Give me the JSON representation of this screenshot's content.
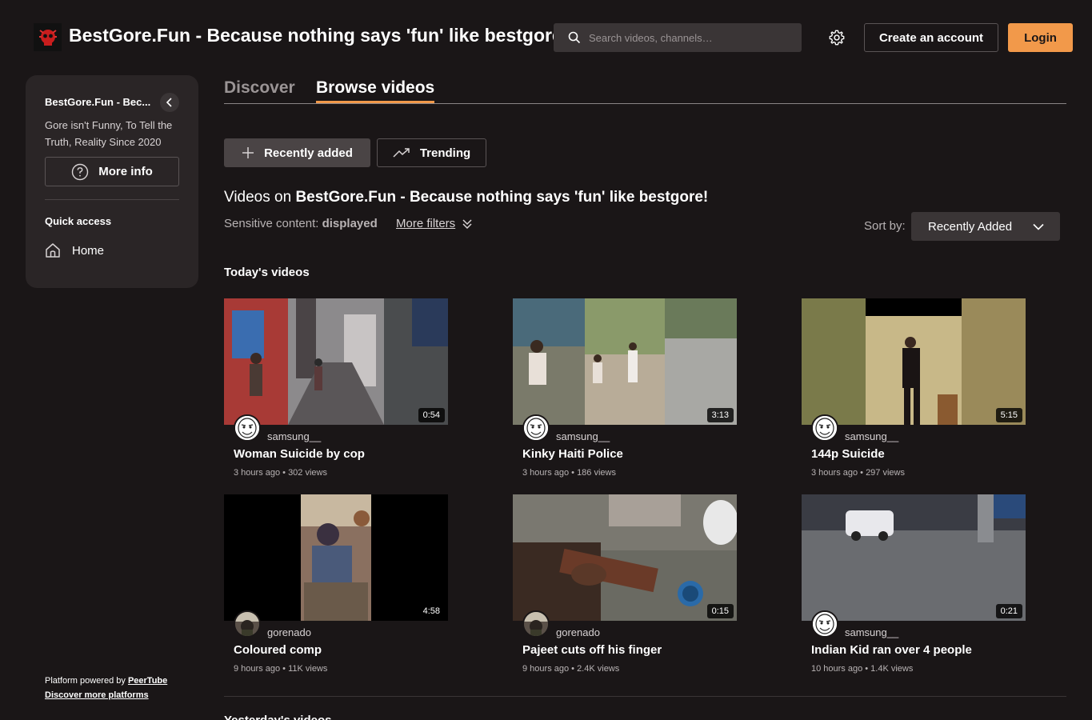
{
  "header": {
    "site_title": "BestGore.Fun - Because nothing says 'fun' like bestgore!",
    "search_placeholder": "Search videos, channels…",
    "create_account": "Create an account",
    "login": "Login",
    "accent_color": "#f2994a"
  },
  "sidebar": {
    "instance_name": "BestGore.Fun - Bec...",
    "description": "Gore isn't Funny, To Tell the Truth, Reality Since 2020",
    "more_info": "More info",
    "quick_access": "Quick access",
    "home": "Home",
    "footer_powered": "Platform powered by ",
    "footer_peertube": "PeerTube",
    "footer_discover": "Discover more platforms"
  },
  "tabs": {
    "discover": "Discover",
    "browse": "Browse videos"
  },
  "filters": {
    "recently_added": "Recently added",
    "trending": "Trending",
    "videos_on_prefix": "Videos on ",
    "videos_on_name": "BestGore.Fun - Because nothing says 'fun' like bestgore!",
    "sensitive_label": "Sensitive content: ",
    "sensitive_value": "displayed",
    "more_filters": "More filters",
    "sort_label": "Sort by:",
    "sort_value": "Recently Added"
  },
  "sections": {
    "today": "Today's videos",
    "yesterday": "Yesterday's videos"
  },
  "videos": [
    {
      "title": "Woman Suicide by cop",
      "channel": "samsung__",
      "duration": "0:54",
      "meta": "3 hours ago • 302 views"
    },
    {
      "title": "Kinky Haiti Police",
      "channel": "samsung__",
      "duration": "3:13",
      "meta": "3 hours ago • 186 views"
    },
    {
      "title": "144p Suicide",
      "channel": "samsung__",
      "duration": "5:15",
      "meta": "3 hours ago • 297 views"
    },
    {
      "title": "Coloured comp",
      "channel": "gorenado",
      "duration": "4:58",
      "meta": "9 hours ago • 11K views"
    },
    {
      "title": "Pajeet cuts off his finger",
      "channel": "gorenado",
      "duration": "0:15",
      "meta": "9 hours ago • 2.4K views"
    },
    {
      "title": "Indian Kid ran over 4 people",
      "channel": "samsung__",
      "duration": "0:21",
      "meta": "10 hours ago • 1.4K views"
    }
  ]
}
